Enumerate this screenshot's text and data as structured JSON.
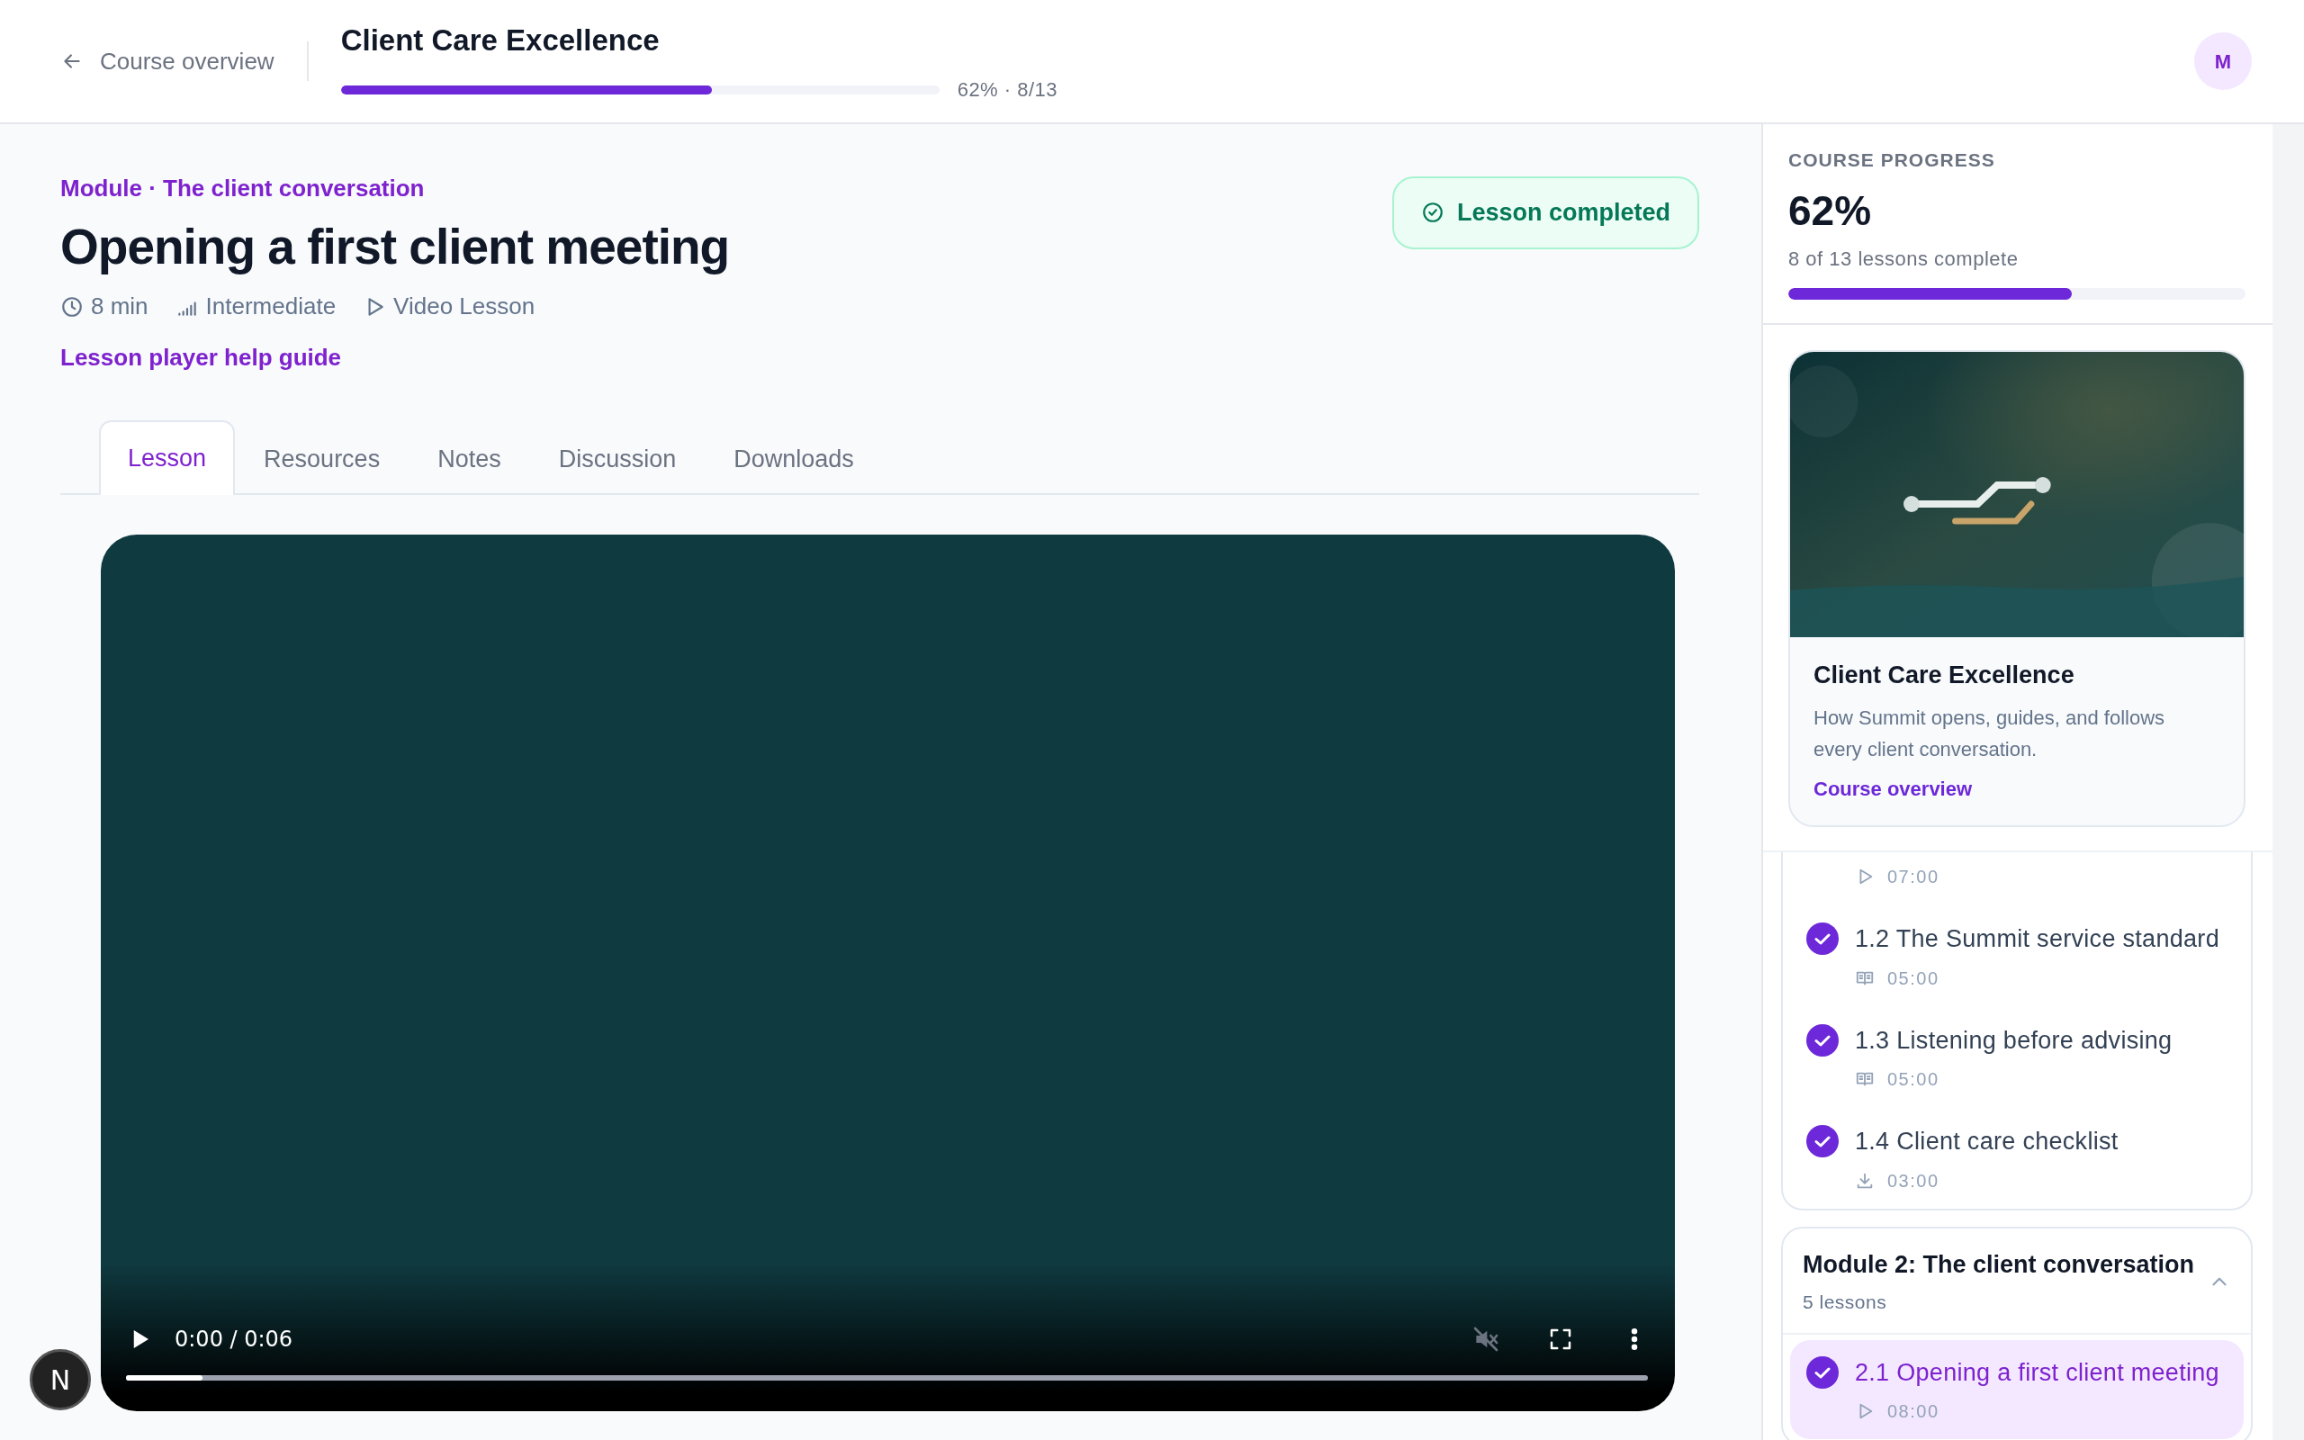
{
  "header": {
    "back_link": "Course overview",
    "course_title": "Client Care Excellence",
    "progress": {
      "level": 0.62,
      "label": "62% · 8/13"
    },
    "avatar": "M"
  },
  "lesson": {
    "module_label": "Module · The client conversation",
    "title": "Opening a first client meeting",
    "meta": [
      {
        "kind": "duration",
        "text": "8 min"
      },
      {
        "kind": "difficulty",
        "text": "Intermediate"
      },
      {
        "kind": "format",
        "text": "Video Lesson"
      }
    ],
    "help_link": "Lesson player help guide",
    "status_badge": {
      "text": "Lesson completed",
      "completed": true
    }
  },
  "tabs": [
    {
      "label": "Lesson",
      "selected": true
    },
    {
      "label": "Resources",
      "selected": false
    },
    {
      "label": "Notes",
      "selected": false
    },
    {
      "label": "Discussion",
      "selected": false
    },
    {
      "label": "Downloads",
      "selected": false
    }
  ],
  "video": {
    "time": "0:00 / 0:06",
    "level": 0.05,
    "muted": true
  },
  "sidebar": {
    "progress": {
      "label": "COURSE PROGRESS",
      "percent": "62%",
      "summary": "8 of 13 lessons complete",
      "level": 0.62
    },
    "course_card": {
      "title": "Client Care Excellence",
      "description": "How Summit opens, guides, and follows every client conversation.",
      "link": "Course overview"
    },
    "modules": [
      {
        "lessons": [
          {
            "kind": "video",
            "duration": "07:00"
          },
          {
            "kind": "reading",
            "title": "1.2 The Summit service standard",
            "duration": "05:00",
            "completed": true,
            "selected": false
          },
          {
            "kind": "reading",
            "title": "1.3 Listening before advising",
            "duration": "05:00",
            "completed": true,
            "selected": false
          },
          {
            "kind": "download",
            "title": "1.4 Client care checklist",
            "duration": "03:00",
            "completed": true,
            "selected": false
          }
        ]
      },
      {
        "title": "Module 2: The client conversation",
        "count": "5 lessons",
        "expanded": true,
        "lessons": [
          {
            "kind": "video",
            "title": "2.1 Opening a first client meeting",
            "duration": "08:00",
            "completed": true,
            "selected": true
          }
        ]
      }
    ]
  },
  "dev_badge": "N"
}
